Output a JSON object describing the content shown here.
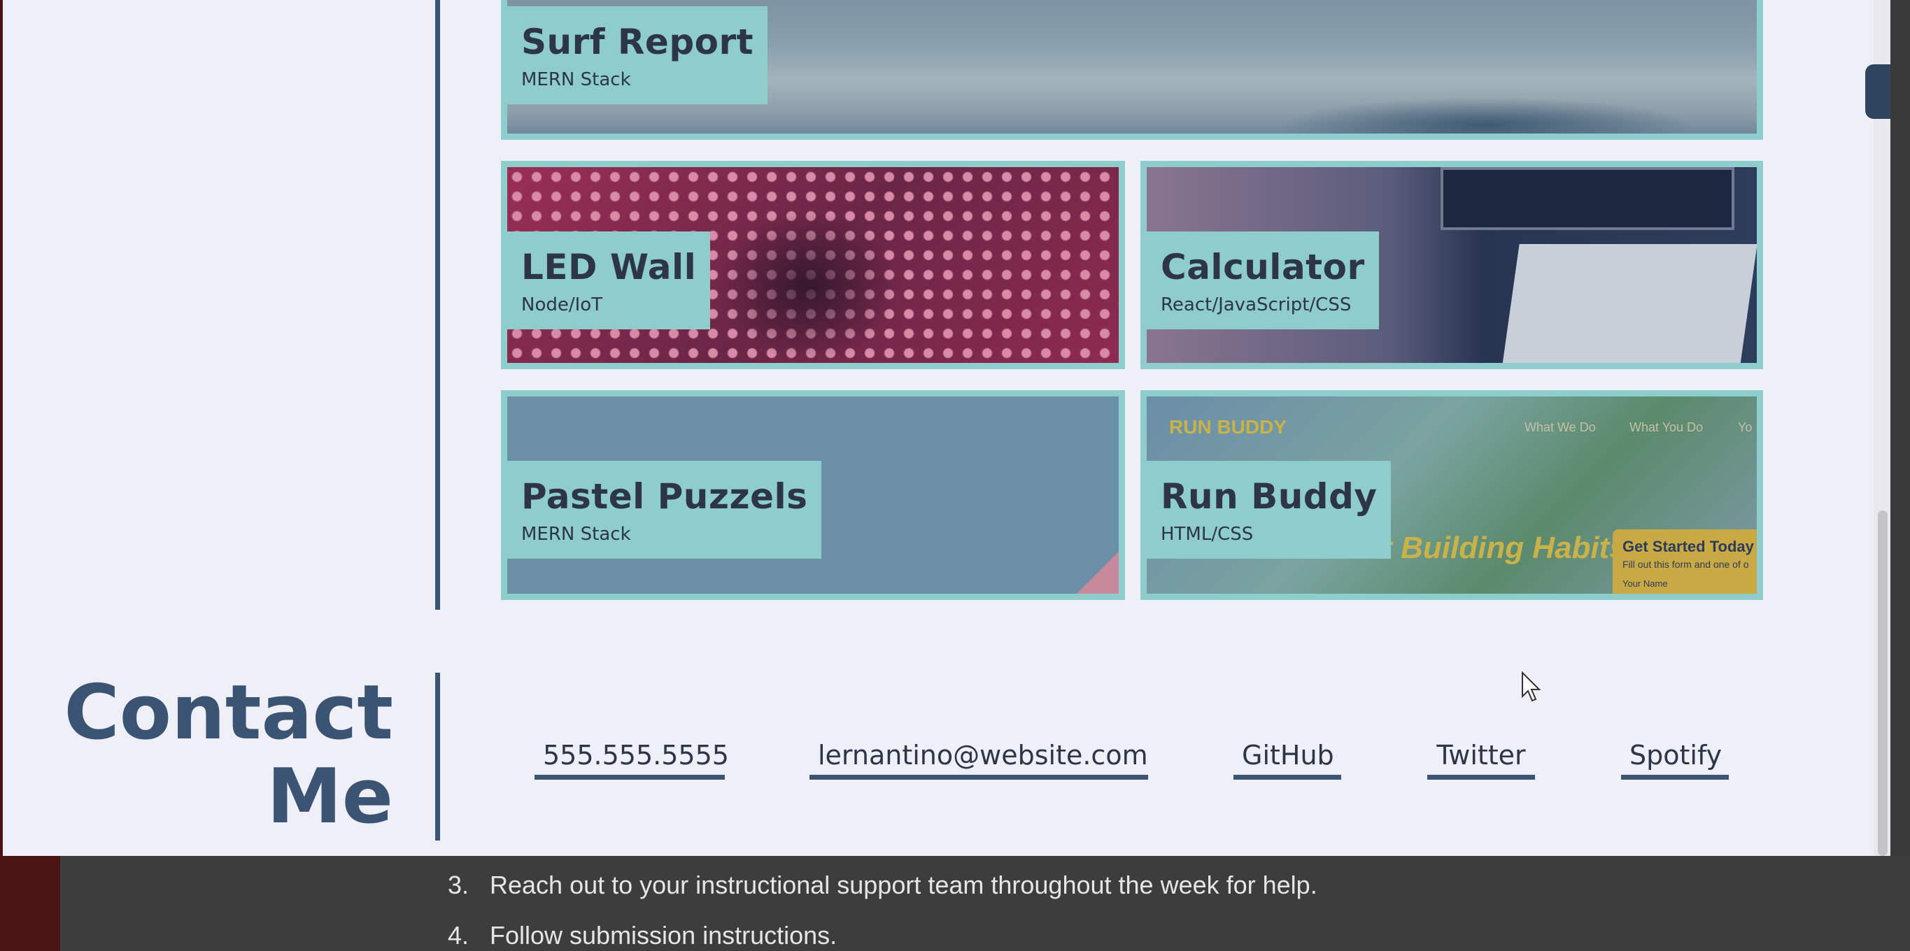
{
  "background_page": {
    "list_items": [
      {
        "num": "3.",
        "text": "Reach out to your instructional support team throughout the week for help."
      },
      {
        "num": "4.",
        "text": "Follow submission instructions."
      }
    ]
  },
  "projects": [
    {
      "title": "Surf Report",
      "stack": "MERN Stack"
    },
    {
      "title": "LED Wall",
      "stack": "Node/IoT"
    },
    {
      "title": "Calculator",
      "stack": "React/JavaScript/CSS"
    },
    {
      "title": "Pastel Puzzels",
      "stack": "MERN Stack"
    },
    {
      "title": "Run Buddy",
      "stack": "HTML/CSS"
    }
  ],
  "run_buddy_preview": {
    "logo": "RUN BUDDY",
    "nav": [
      "What We Do",
      "What You Do",
      "Yo"
    ],
    "hero": "tart Building Habits",
    "form_title": "Get Started Today",
    "form_sub": "Fill out this form and one of o",
    "form_field": "Your Name"
  },
  "contact": {
    "title_line1": "Contact",
    "title_line2": "Me",
    "links": {
      "phone": "555.555.5555",
      "email": "lernantino@website.com",
      "github": "GitHub",
      "twitter": "Twitter",
      "spotify": "Spotify"
    }
  },
  "colors": {
    "accent": "#3c5474",
    "card_border": "#8fcccc",
    "page_bg": "#efeff7"
  }
}
